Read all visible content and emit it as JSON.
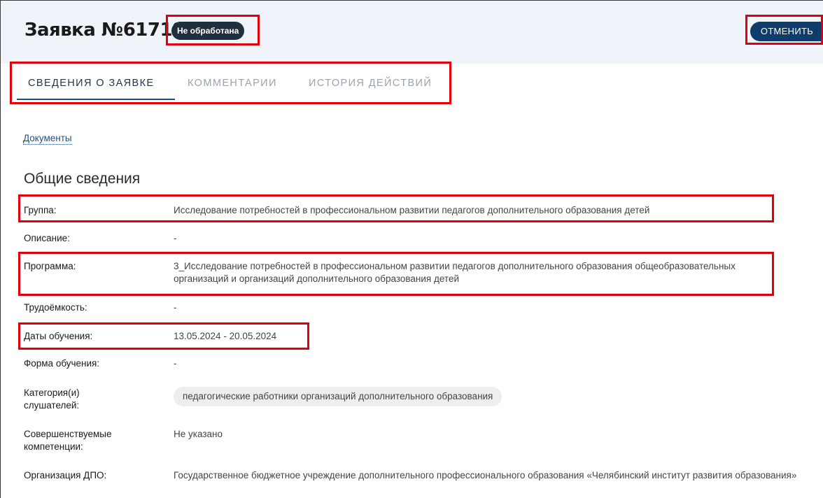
{
  "header": {
    "title": "Заявка №61718",
    "status_badge": "Не обработана",
    "cancel_label": "ОТМЕНИТЬ"
  },
  "tabs": [
    {
      "label": "СВЕДЕНИЯ О ЗАЯВКЕ",
      "active": true
    },
    {
      "label": "КОММЕНТАРИИ",
      "active": false
    },
    {
      "label": "ИСТОРИЯ ДЕЙСТВИЙ",
      "active": false
    }
  ],
  "documents_link": "Документы",
  "section_title": "Общие сведения",
  "fields": {
    "group": {
      "label": "Группа:",
      "value": "Исследование потребностей в профессиональном развитии педагогов дополнительного образования детей"
    },
    "description": {
      "label": "Описание:",
      "value": "-"
    },
    "program": {
      "label": "Программа:",
      "value": "3_Исследование потребностей в профессиональном развитии педагогов дополнительного образования общеобразовательных организаций и организаций дополнительного образования детей"
    },
    "workload": {
      "label": "Трудоёмкость:",
      "value": "-"
    },
    "dates": {
      "label": "Даты обучения:",
      "value": "13.05.2024 - 20.05.2024"
    },
    "form": {
      "label": "Форма обучения:",
      "value": "-"
    },
    "categories": {
      "label": "Категория(и) слушателей:",
      "value": "педагогические работники организаций дополнительного образования"
    },
    "competencies": {
      "label": "Совершенствуемые компетенции:",
      "value": "Не указано"
    },
    "organization": {
      "label": "Организация ДПО:",
      "value": "Государственное бюджетное учреждение дополнительного профессионального образования «Челябинский институт развития образования»"
    }
  },
  "colors": {
    "header_bg": "#eef4f9",
    "badge_bg": "#1f2f3d",
    "accent": "#0f3d6b",
    "highlight": "#e0000a"
  }
}
